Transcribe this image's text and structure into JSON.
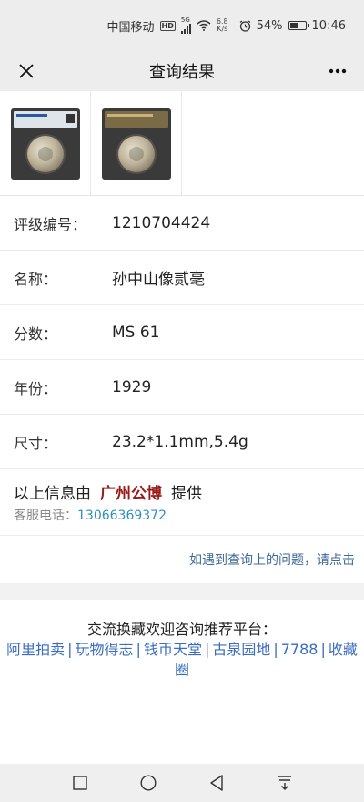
{
  "status_bar": {
    "carrier": "中国移动",
    "hd": "HD",
    "network": "5G",
    "speed_value": "6.8",
    "speed_unit": "K/s",
    "battery_percent": "54%",
    "battery_level": 0.54,
    "time": "10:46"
  },
  "nav": {
    "title": "查询结果",
    "close_icon": "close-icon",
    "more_icon": "more-icon"
  },
  "thumbnails": [
    {
      "name": "coin-slab-front-image"
    },
    {
      "name": "coin-slab-back-image"
    }
  ],
  "info": {
    "rows": [
      {
        "label": "评级编号：",
        "value": "1210704424"
      },
      {
        "label": "名称：",
        "value": "孙中山像贰毫"
      },
      {
        "label": "分数：",
        "value": "MS 61"
      },
      {
        "label": "年份：",
        "value": "1929"
      },
      {
        "label": "尺寸：",
        "value": "23.2*1.1mm,5.4g"
      }
    ]
  },
  "provider": {
    "prefix": "以上信息由",
    "name": "广州公博",
    "suffix": "提供",
    "phone_label": "客服电话：",
    "phone": "13066369372"
  },
  "problem_link": "如遇到查询上的问题，请点击",
  "platforms": {
    "title": "交流换藏欢迎咨询推荐平台：",
    "links": [
      "阿里拍卖",
      "玩物得志",
      "钱币天堂",
      "古泉园地",
      "7788",
      "收藏圈"
    ]
  },
  "colors": {
    "provider_name": "#9a1a1a",
    "phone_link": "#2f8fbf",
    "platform_link": "#3a6cc0",
    "problem_link": "#3e6a9a"
  },
  "android_nav": [
    "square-icon",
    "circle-icon",
    "back-triangle-icon",
    "notification-pull-icon"
  ]
}
